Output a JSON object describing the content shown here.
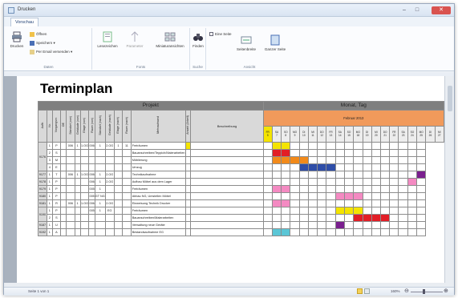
{
  "window": {
    "title": "Drucken"
  },
  "ribbon": {
    "tab": "Vorschau",
    "groups": {
      "data": {
        "label": "Daten",
        "print": "Drucken",
        "open": "Öffnen",
        "save": "Speichern",
        "email": "Per Email versenden"
      },
      "fonts": {
        "label": "Fonts",
        "letters": "Lesezeichen",
        "params": "Parameter",
        "thumbs": "Miniaturansichten"
      },
      "search": {
        "label": "Suche",
        "find": "Finden"
      },
      "view": {
        "label": "Ansicht",
        "onepage": "Eine Seite",
        "pagewidth": "Seitenbreite",
        "wholepage": "Ganzer Seite"
      }
    }
  },
  "status": {
    "page": "Seite 1 von 1",
    "zoom": "160%"
  },
  "doc": {
    "title": "Terminplan"
  },
  "table": {
    "projekt_header": "Projekt",
    "monat_header": "Monat, Tag",
    "month": "Februar 2013",
    "col_headers": [
      "Auftr.",
      "Nr.",
      "Vorgangsnr.",
      "OE",
      "Standort (von)",
      "Gebäude (von)",
      "Etage (von)",
      "Raum (von)",
      "Standort (nach)",
      "Gebäude (nach)",
      "Etage (nach)",
      "Raum (nach)",
      "Mehraufwand",
      "Anzahl (Arbeit)",
      "Beschreibung"
    ],
    "days": [
      {
        "dow": "FR",
        "d": "5"
      },
      {
        "dow": "SA",
        "d": "7"
      },
      {
        "dow": "SO",
        "d": "8"
      },
      {
        "dow": "MO",
        "d": "9"
      },
      {
        "dow": "DI",
        "d": "10"
      },
      {
        "dow": "MI",
        "d": "11"
      },
      {
        "dow": "DO",
        "d": "12"
      },
      {
        "dow": "FR",
        "d": "13"
      },
      {
        "dow": "SA",
        "d": "14"
      },
      {
        "dow": "SO",
        "d": "15"
      },
      {
        "dow": "MO",
        "d": "18"
      },
      {
        "dow": "DI",
        "d": "19"
      },
      {
        "dow": "MI",
        "d": "20"
      },
      {
        "dow": "DO",
        "d": "21"
      },
      {
        "dow": "FR",
        "d": "22"
      },
      {
        "dow": "SA",
        "d": "23"
      },
      {
        "dow": "SO",
        "d": "24"
      },
      {
        "dow": "MO",
        "d": "25"
      },
      {
        "dow": "DI",
        "d": "26"
      },
      {
        "dow": "MI",
        "d": "27"
      }
    ],
    "bar_colors": {
      "yellow": "#f4e400",
      "red": "#e21e26",
      "orange": "#f28a1a",
      "blue": "#2f4ea8",
      "purple": "#7a1f8e",
      "pink": "#f48ac2",
      "cyan": "#5bc6d6"
    },
    "rows": [
      {
        "auftr": "9176",
        "span": 4,
        "nr": "1",
        "vg": "P",
        "oe": "",
        "c": [
          "006",
          "1",
          "1.OG",
          "006",
          "1",
          "2.OG",
          "1"
        ],
        "n": "11",
        "desc": "Freiräumen",
        "bars": [
          [
            0,
            1,
            "yellow"
          ],
          [
            3,
            2,
            "yellow"
          ]
        ]
      },
      {
        "nr": "2",
        "vg": "S",
        "oe": "",
        "c": [
          "",
          "",
          "",
          "",
          "",
          "",
          ""
        ],
        "n": "",
        "desc": "Bauanschreiben/Teppich/Malerarbeiten",
        "bars": [
          [
            3,
            2,
            "red"
          ]
        ]
      },
      {
        "nr": "3",
        "vg": "M",
        "oe": "",
        "c": [
          "",
          "",
          "",
          "",
          "",
          "",
          ""
        ],
        "n": "",
        "desc": "Möblierung",
        "bars": [
          [
            3,
            4,
            "orange"
          ]
        ]
      },
      {
        "nr": "4",
        "vg": "E",
        "oe": "",
        "c": [
          "",
          "",
          "",
          "",
          "",
          "",
          ""
        ],
        "n": "",
        "desc": "Umzug",
        "bars": [
          [
            6,
            4,
            "blue"
          ]
        ]
      },
      {
        "auftr": "9177",
        "nr": "1",
        "vg": "T",
        "oe": "",
        "c": [
          "006",
          "1",
          "1.OG",
          "006",
          "1",
          "2.OG",
          ""
        ],
        "n": "",
        "desc": "Technikaufnahme",
        "bars": [
          [
            19,
            1,
            "purple"
          ]
        ]
      },
      {
        "auftr": "9178",
        "nr": "1",
        "vg": "P",
        "oe": "",
        "c": [
          "",
          "",
          "",
          "006",
          "1",
          "2.OG",
          ""
        ],
        "n": "",
        "desc": "Aufbau Möbel aus dem Lager",
        "bars": [
          [
            18,
            1,
            "pink"
          ]
        ]
      },
      {
        "auftr": "9179",
        "nr": "1",
        "vg": "P",
        "oe": "",
        "c": [
          "",
          "",
          "",
          "005",
          "1",
          "",
          ""
        ],
        "n": "",
        "desc": "Freiräumen",
        "bars": [
          [
            3,
            2,
            "pink"
          ]
        ]
      },
      {
        "auftr": "9180",
        "nr": "1",
        "vg": "P",
        "oe": "",
        "c": [
          "",
          "",
          "",
          "005",
          "GT NG",
          "",
          ""
        ],
        "n": "",
        "desc": "Abbau NG, Umstellen Möbel",
        "bars": [
          [
            10,
            3,
            "pink"
          ]
        ]
      },
      {
        "auftr": "9181",
        "nr": "1",
        "vg": "R",
        "oe": "",
        "c": [
          "006",
          "1",
          "1.OG",
          "006",
          "1",
          "2.OG",
          ""
        ],
        "n": "",
        "desc": "Einweisung Technik Drucker",
        "bars": [
          [
            3,
            2,
            "pink"
          ]
        ]
      },
      {
        "auftr": "9190",
        "span": 2,
        "nr": "1",
        "vg": "P",
        "oe": "",
        "c": [
          "",
          "",
          "",
          "005",
          "1",
          "EG",
          ""
        ],
        "n": "",
        "desc": "Freiräumen",
        "bars": [
          [
            10,
            3,
            "yellow"
          ]
        ]
      },
      {
        "nr": "2",
        "vg": "S",
        "oe": "",
        "c": [
          "",
          "",
          "",
          "",
          "",
          "",
          ""
        ],
        "n": "",
        "desc": "Bauanschreiben/Malerarbeiten",
        "bars": [
          [
            12,
            4,
            "red"
          ]
        ]
      },
      {
        "auftr": "9187",
        "nr": "1",
        "vg": "U",
        "oe": "",
        "c": [
          "",
          "",
          "",
          "",
          "",
          "",
          ""
        ],
        "n": "",
        "desc": "Verwaltung neue Geräte",
        "bars": [
          [
            10,
            1,
            "purple"
          ]
        ]
      },
      {
        "auftr": "9192",
        "nr": "1",
        "vg": "A",
        "oe": "",
        "c": [
          "",
          "",
          "",
          "",
          "",
          "",
          ""
        ],
        "n": "",
        "desc": "Bestandsaufnahme EG",
        "bars": [
          [
            3,
            2,
            "cyan"
          ]
        ]
      }
    ]
  }
}
